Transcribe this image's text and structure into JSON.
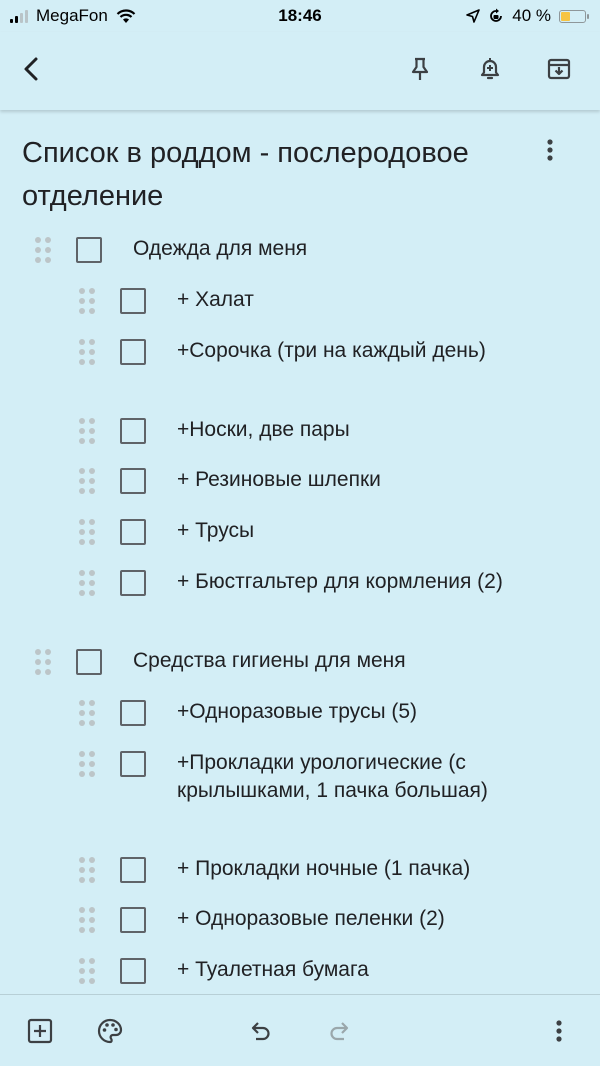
{
  "status_bar": {
    "carrier": "MegaFon",
    "time": "18:46",
    "battery": "40 %",
    "battery_level": 0.4
  },
  "toolbar": {
    "back_icon": "back-arrow-icon",
    "pin_icon": "pin-icon",
    "reminder_icon": "bell-plus-icon",
    "archive_icon": "archive-icon"
  },
  "note": {
    "title": "Список в роддом - послеродовое отделение"
  },
  "list": [
    {
      "text": "Одежда для меня",
      "level": 0,
      "checked": false
    },
    {
      "text": "+ Халат",
      "level": 1,
      "checked": false
    },
    {
      "text": "+Сорочка (три на каждый день)",
      "level": 1,
      "checked": false
    },
    {
      "text": "+Носки, две пары",
      "level": 1,
      "checked": false
    },
    {
      "text": "+ Резиновые шлепки",
      "level": 1,
      "checked": false
    },
    {
      "text": "+ Трусы",
      "level": 1,
      "checked": false
    },
    {
      "text": "+ Бюстгальтер для кормления (2)",
      "level": 1,
      "checked": false
    },
    {
      "text": "Средства гигиены для меня",
      "level": 0,
      "checked": false
    },
    {
      "text": "+Одноразовые трусы (5)",
      "level": 1,
      "checked": false
    },
    {
      "text": "+Прокладки урологические (с крылышками, 1 пачка большая)",
      "level": 1,
      "checked": false
    },
    {
      "text": "+ Прокладки ночные (1 пачка)",
      "level": 1,
      "checked": false
    },
    {
      "text": "+ Одноразовые пеленки (2)",
      "level": 1,
      "checked": false
    },
    {
      "text": "+ Туалетная бумага",
      "level": 1,
      "checked": false
    }
  ],
  "bottom_bar": {
    "add_icon": "add-box-icon",
    "palette_icon": "palette-icon",
    "undo_icon": "undo-icon",
    "redo_icon": "redo-icon",
    "more_icon": "more-vert-icon"
  }
}
